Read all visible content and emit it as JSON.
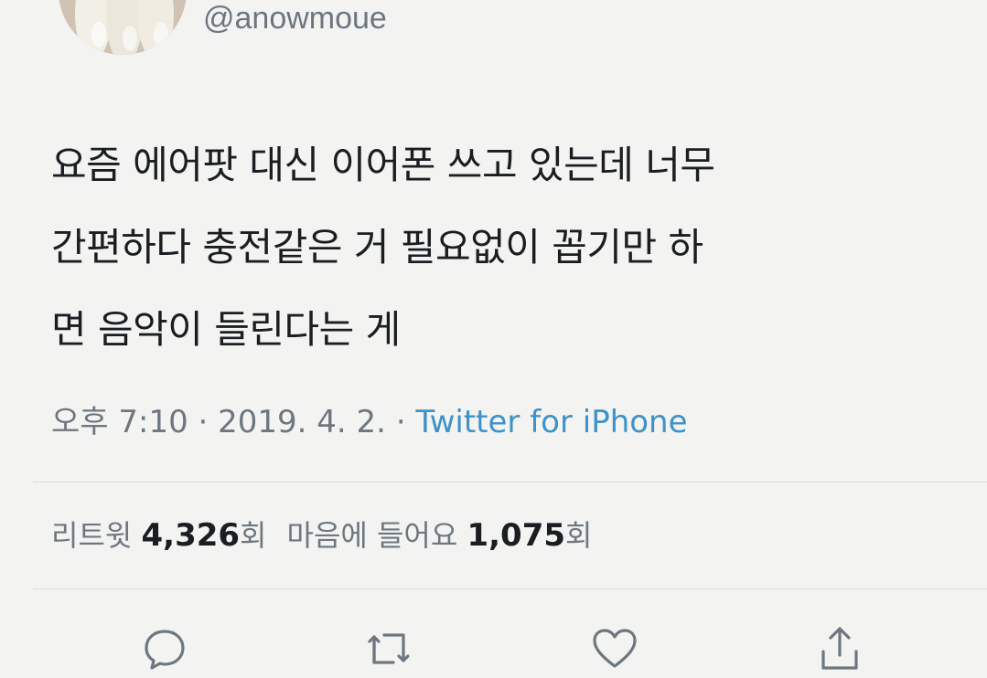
{
  "profile": {
    "handle": "@anowmoue",
    "avatar_icon": "avatar-photo"
  },
  "tweet": {
    "lines": [
      "요즘 에어팟 대신 이어폰 쓰고 있는데 너무",
      "간편하다 충전같은 거 필요없이 꼽기만 하",
      "면 음악이 들린다는 게"
    ]
  },
  "meta": {
    "time": "오후 7:10",
    "separator": "·",
    "date": "2019. 4. 2.",
    "source": "Twitter for iPhone"
  },
  "stats": {
    "retweet_label": "리트윗",
    "retweet_count": "4,326",
    "retweet_unit": "회",
    "like_label": "마음에 들어요",
    "like_count": "1,075",
    "like_unit": "회"
  },
  "actions": {
    "reply_icon": "reply-icon",
    "retweet_icon": "retweet-icon",
    "like_icon": "heart-icon",
    "share_icon": "share-icon"
  },
  "colors": {
    "background": "#f3f4f1",
    "text": "#1a1d21",
    "muted": "#6e7780",
    "link": "#3f92c9",
    "divider": "#d8dbde"
  }
}
